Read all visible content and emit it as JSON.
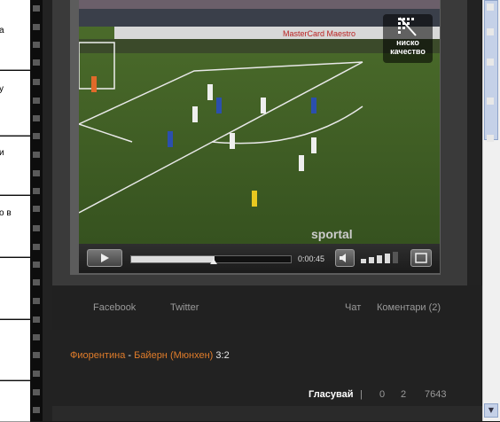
{
  "sidebar": {
    "items": [
      "а",
      "у",
      "и",
      "о в",
      "",
      "",
      ""
    ]
  },
  "player": {
    "quality_label_line1": "ниско",
    "quality_label_line2": "качество",
    "time": "0:00:45",
    "progress": 0.52,
    "volume_level": 0.75,
    "watermark": "sportal",
    "ads_banner": "Master Card Maestro"
  },
  "links": {
    "facebook": "Facebook",
    "twitter": "Twitter",
    "chat": "Чат",
    "comments": "Коментари (2)"
  },
  "match": {
    "team1": "Фиорентина",
    "separator": " - ",
    "team2": "Байерн (Мюнхен)",
    "score": "3:2"
  },
  "votes": {
    "label": "Гласувай",
    "sep": "|",
    "v1": "0",
    "v2": "2",
    "v3": "7643"
  }
}
